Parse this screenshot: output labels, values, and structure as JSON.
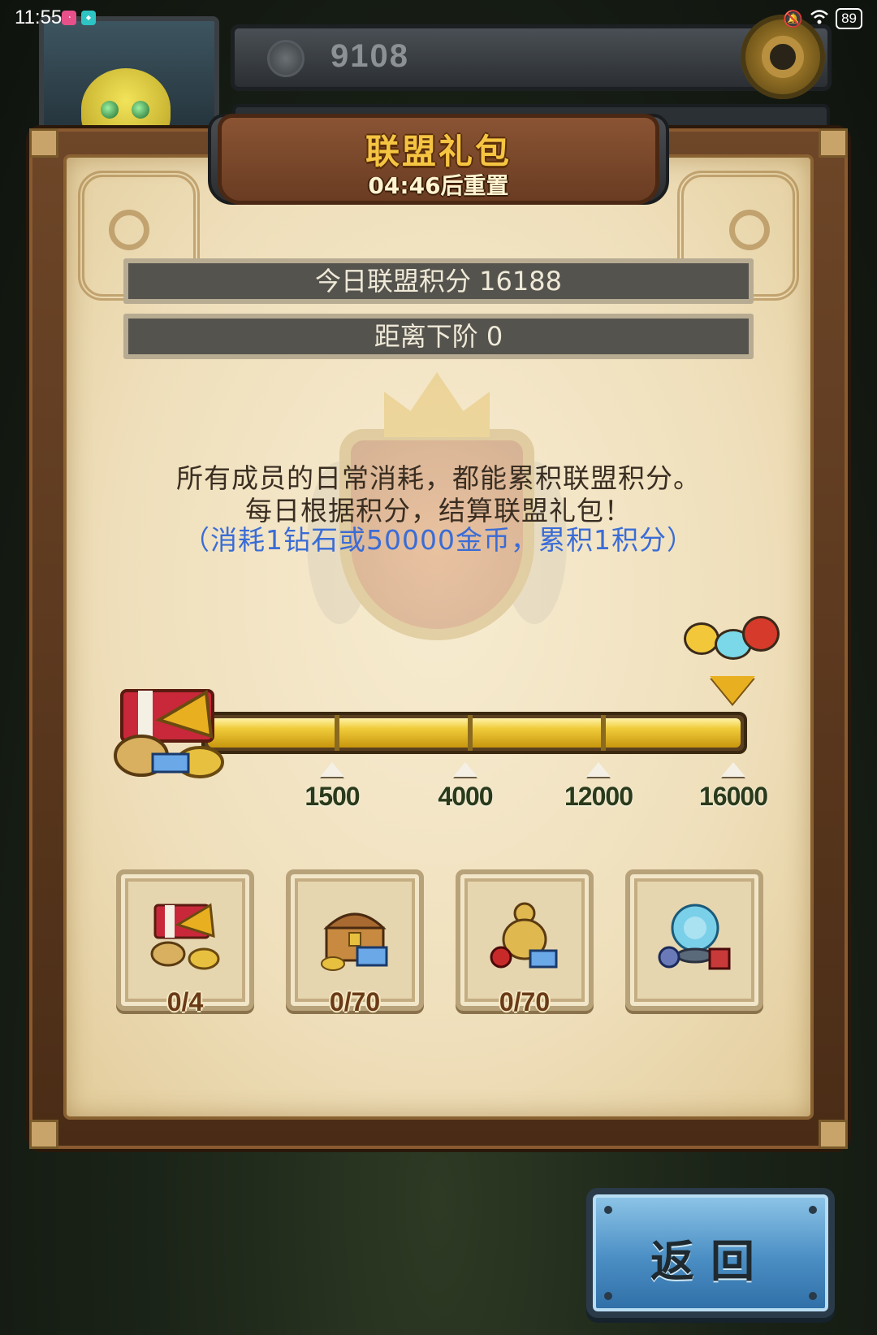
{
  "status_bar": {
    "time": "11:55",
    "battery": "89",
    "icons": [
      "notification-app-icon",
      "tap-app-icon",
      "mute-icon",
      "wifi-icon",
      "battery-icon"
    ]
  },
  "hud": {
    "currency_value": "9108",
    "currency_icon": "coin-icon",
    "settings_icon": "gear-icon"
  },
  "panel": {
    "title": "联盟礼包",
    "subtitle": "04:46后重置",
    "today_score": "今日联盟积分 16188",
    "next_tier": "距离下阶 0",
    "description_line1": "所有成员的日常消耗，都能累积联盟积分。",
    "description_line2": "每日根据积分，结算联盟礼包！",
    "description_note": "（消耗1钻石或50000金币，累积1积分）"
  },
  "progress": {
    "fill_fraction": 1.0,
    "milestones": [
      "1500",
      "4000",
      "12000",
      "16000"
    ]
  },
  "rewards": [
    {
      "count": "0/4",
      "icon": "horn-chest-icon"
    },
    {
      "count": "0/70",
      "icon": "treasure-chest-icon"
    },
    {
      "count": "0/70",
      "icon": "gourd-items-icon"
    },
    {
      "count": "",
      "icon": "orb-items-icon"
    }
  ],
  "buttons": {
    "back": "返回"
  },
  "colors": {
    "title_gold": "#f5c542",
    "note_blue": "#3a6cd6",
    "bar_fill": "#f0cc3a",
    "back_button": "#4a8ec4"
  }
}
